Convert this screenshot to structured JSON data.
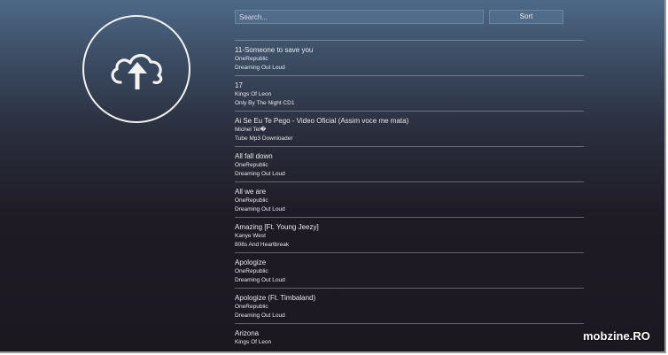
{
  "search": {
    "placeholder": "Search..."
  },
  "toolbar": {
    "sort_label": "Sort"
  },
  "upload": {
    "icon": "cloud-upload-icon"
  },
  "songs": [
    {
      "title": "11-Someone to save you",
      "artist": "OneRepublic",
      "album": "Dreaming Out Loud"
    },
    {
      "title": "17",
      "artist": "Kings Of Leon",
      "album": "Only By The Night CD1"
    },
    {
      "title": "Ai Se Eu Te Pego - Video Oficial (Assim voce me mata)",
      "artist": "Michel Tel�",
      "album": "Tube Mp3 Downloader"
    },
    {
      "title": "All fall down",
      "artist": "OneRepublic",
      "album": "Dreaming Out Loud"
    },
    {
      "title": "All we are",
      "artist": "OneRepublic",
      "album": "Dreaming Out Loud"
    },
    {
      "title": "Amazing [Ft. Young Jeezy]",
      "artist": "Kanye West",
      "album": "808s And Heartbreak"
    },
    {
      "title": "Apologize",
      "artist": "OneRepublic",
      "album": "Dreaming Out Loud"
    },
    {
      "title": "Apologize (Ft. Timbaland)",
      "artist": "OneRepublic",
      "album": "Dreaming Out Loud"
    },
    {
      "title": "Arizona",
      "artist": "Kings Of Leon",
      "album": ""
    }
  ],
  "watermark": "mobzine.RO",
  "colors": {
    "text": "#e8e8ec",
    "divider": "#d2d7e1",
    "accent": "#5a7696"
  }
}
